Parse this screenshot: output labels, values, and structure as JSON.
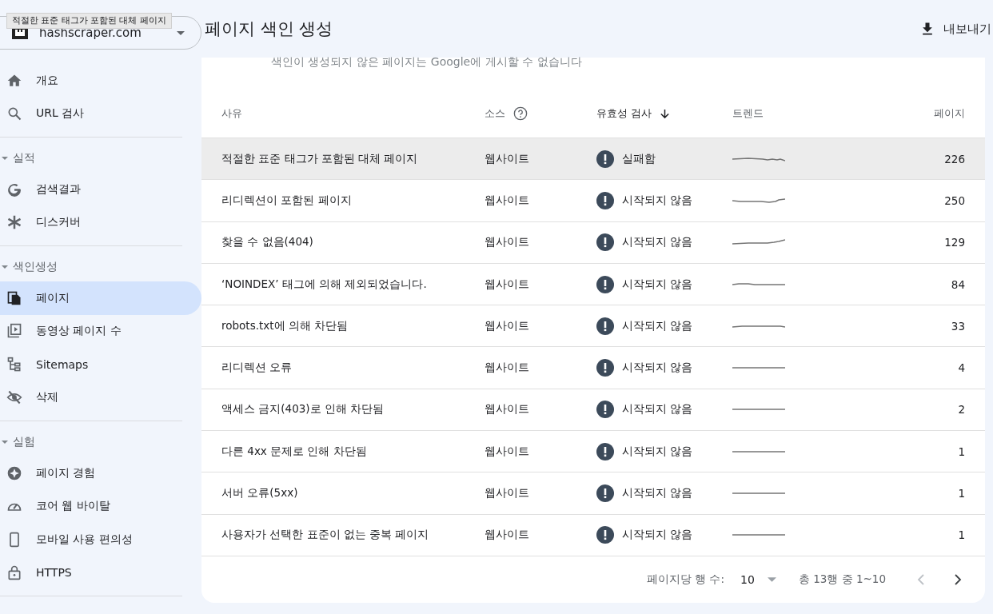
{
  "tooltip": "적절한 표준 태그가 포함된 대체 페이지",
  "site_selector": {
    "value": "hashscraper.com"
  },
  "sidebar": {
    "sections": [
      {
        "items": [
          {
            "label": "개요",
            "selected": false
          },
          {
            "label": "URL 검사",
            "selected": false
          }
        ]
      },
      {
        "title": "실적",
        "expanded": true,
        "items": [
          {
            "label": "검색결과",
            "selected": false
          },
          {
            "label": "디스커버",
            "selected": false
          }
        ]
      },
      {
        "title": "색인생성",
        "expanded": true,
        "items": [
          {
            "label": "페이지",
            "selected": true
          },
          {
            "label": "동영상 페이지 수",
            "selected": false
          },
          {
            "label": "Sitemaps",
            "selected": false
          },
          {
            "label": "삭제",
            "selected": false
          }
        ]
      },
      {
        "title": "실험",
        "expanded": true,
        "items": [
          {
            "label": "페이지 경험",
            "selected": false
          },
          {
            "label": "코어 웹 바이탈",
            "selected": false
          },
          {
            "label": "모바일 사용 편의성",
            "selected": false
          },
          {
            "label": "HTTPS",
            "selected": false
          }
        ]
      }
    ]
  },
  "page_title": "페이지 색인 생성",
  "export_button": "내보내기",
  "subtitle": "색인이 생성되지 않은 페이지는 Google에 게시할 수 없습니다",
  "table": {
    "columns": [
      {
        "label": "사유",
        "kind": "plain"
      },
      {
        "label": "소스",
        "kind": "help"
      },
      {
        "label": "유효성 검사",
        "kind": "sorted"
      },
      {
        "label": "트렌드",
        "kind": "plain"
      },
      {
        "label": "페이지",
        "kind": "plain"
      }
    ],
    "rows": [
      {
        "reason": "적절한 표준 태그가 포함된 대체 페이지",
        "source": "웹사이트",
        "validation": "실패함",
        "pages": "226",
        "selected": true
      },
      {
        "reason": "리디렉션이 포함된 페이지",
        "source": "웹사이트",
        "validation": "시작되지 않음",
        "pages": "250",
        "selected": false
      },
      {
        "reason": "찾을 수 없음(404)",
        "source": "웹사이트",
        "validation": "시작되지 않음",
        "pages": "129",
        "selected": false
      },
      {
        "reason": "‘NOINDEX’ 태그에 의해 제외되었습니다.",
        "source": "웹사이트",
        "validation": "시작되지 않음",
        "pages": "84",
        "selected": false
      },
      {
        "reason": "robots.txt에 의해 차단됨",
        "source": "웹사이트",
        "validation": "시작되지 않음",
        "pages": "33",
        "selected": false
      },
      {
        "reason": "리디렉션 오류",
        "source": "웹사이트",
        "validation": "시작되지 않음",
        "pages": "4",
        "selected": false
      },
      {
        "reason": "액세스 금지(403)로 인해 차단됨",
        "source": "웹사이트",
        "validation": "시작되지 않음",
        "pages": "2",
        "selected": false
      },
      {
        "reason": "다른 4xx 문제로 인해 차단됨",
        "source": "웹사이트",
        "validation": "시작되지 않음",
        "pages": "1",
        "selected": false
      },
      {
        "reason": "서버 오류(5xx)",
        "source": "웹사이트",
        "validation": "시작되지 않음",
        "pages": "1",
        "selected": false
      },
      {
        "reason": "사용자가 선택한 표준이 없는 중복 페이지",
        "source": "웹사이트",
        "validation": "시작되지 않음",
        "pages": "1",
        "selected": false
      }
    ]
  },
  "pagination": {
    "rows_label": "페이지당 행 수:",
    "rows_value": "10",
    "range": "총 13행 중 1~10"
  }
}
